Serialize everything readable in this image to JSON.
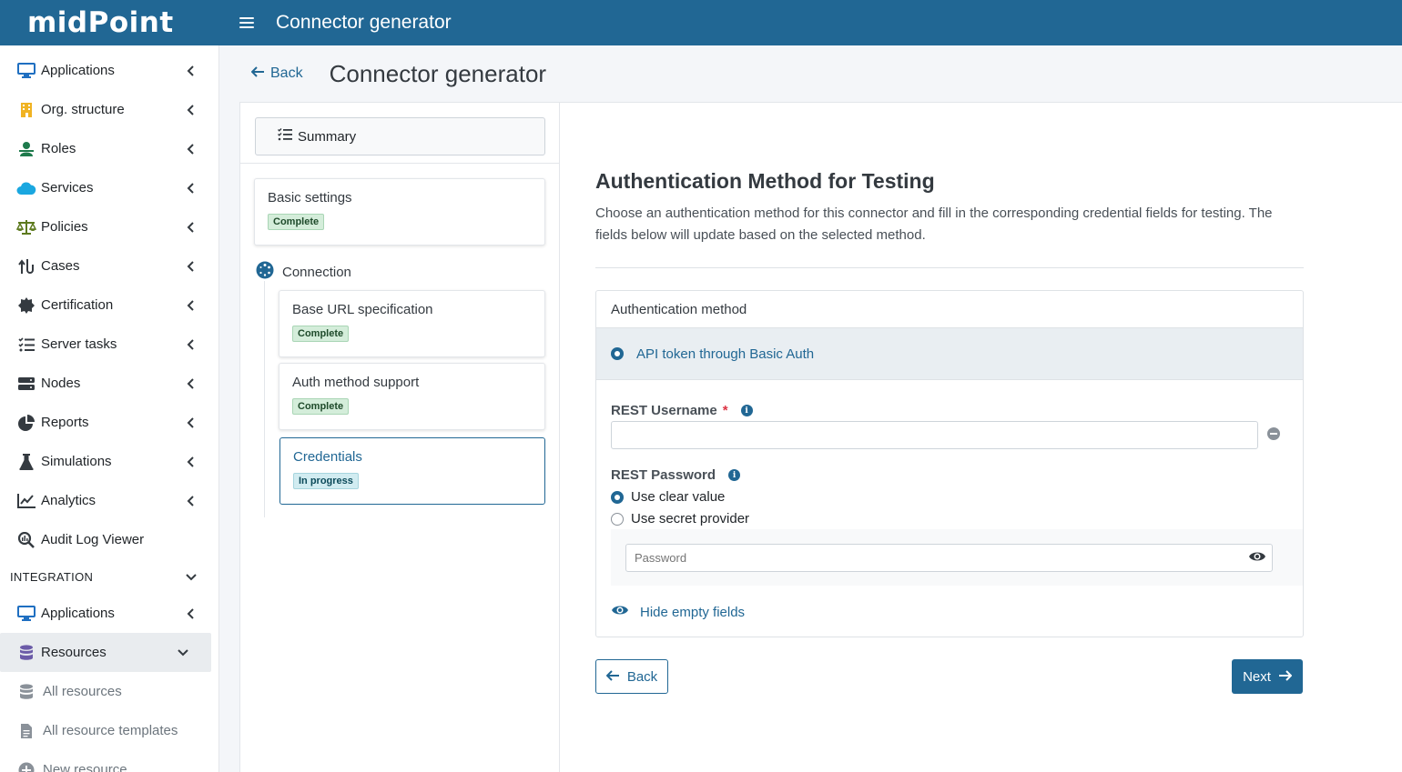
{
  "app": {
    "logo_text": "midPoint",
    "title": "Connector generator"
  },
  "sidebar": {
    "items": [
      {
        "label": "Applications",
        "icon": "monitor-icon"
      },
      {
        "label": "Org. structure",
        "icon": "building-icon"
      },
      {
        "label": "Roles",
        "icon": "user-hat-icon"
      },
      {
        "label": "Services",
        "icon": "cloud-icon"
      },
      {
        "label": "Policies",
        "icon": "scales-icon"
      },
      {
        "label": "Cases",
        "icon": "cases-icon"
      },
      {
        "label": "Certification",
        "icon": "certificate-icon"
      },
      {
        "label": "Server tasks",
        "icon": "tasks-icon"
      },
      {
        "label": "Nodes",
        "icon": "server-icon"
      },
      {
        "label": "Reports",
        "icon": "pie-chart-icon"
      },
      {
        "label": "Simulations",
        "icon": "flask-icon"
      },
      {
        "label": "Analytics",
        "icon": "line-chart-icon"
      },
      {
        "label": "Audit Log Viewer",
        "icon": "search-chart-icon"
      }
    ],
    "section_header": "INTEGRATION",
    "integration_items": [
      {
        "label": "Applications",
        "icon": "monitor-icon"
      },
      {
        "label": "Resources",
        "icon": "database-icon"
      }
    ],
    "resource_subitems": [
      {
        "label": "All resources",
        "icon": "database-icon"
      },
      {
        "label": "All resource templates",
        "icon": "file-icon"
      },
      {
        "label": "New resource",
        "icon": "plus-circle-icon"
      }
    ]
  },
  "header": {
    "back_label": "Back",
    "title": "Connector generator"
  },
  "wizard": {
    "summary_label": "Summary",
    "basic_settings": {
      "label": "Basic settings",
      "status": "Complete"
    },
    "connection_label": "Connection",
    "steps": [
      {
        "label": "Base URL specification",
        "status": "Complete"
      },
      {
        "label": "Auth method support",
        "status": "Complete"
      },
      {
        "label": "Credentials",
        "status": "In progress"
      }
    ]
  },
  "form": {
    "heading": "Authentication Method for Testing",
    "description": "Choose an authentication method for this connector and fill in the corresponding credential fields for testing. The fields below will update based on the selected method.",
    "auth_method_header": "Authentication method",
    "auth_option": "API token through Basic Auth",
    "username_label": "REST Username",
    "required_mark": "*",
    "password_label": "REST Password",
    "use_clear_value": "Use clear value",
    "use_secret_provider": "Use secret provider",
    "password_placeholder": "Password",
    "hide_empty_fields": "Hide empty fields",
    "back_button": "Back",
    "next_button": "Next"
  },
  "colors": {
    "primary": "#216794",
    "complete_badge": "#d4edda",
    "progress_badge": "#d1ecf1"
  }
}
